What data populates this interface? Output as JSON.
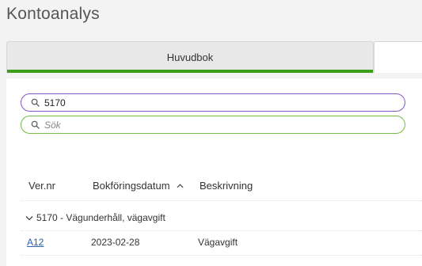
{
  "page": {
    "title": "Kontoanalys"
  },
  "tabs": [
    {
      "label": "Huvudbok",
      "active": true
    },
    {
      "label": "",
      "active": false
    }
  ],
  "search": {
    "filter_value": "5170",
    "placeholder": "Sök"
  },
  "table": {
    "columns": [
      "Ver.nr",
      "Bokföringsdatum",
      "Beskrivning"
    ],
    "sort_column": "Bokföringsdatum",
    "sort_direction": "ascending",
    "groups": [
      {
        "label": "5170 - Vägunderhåll, vägavgift",
        "expanded": true,
        "rows": [
          {
            "vernr": "A12",
            "date": "2023-02-28",
            "description": "Vägavgift"
          }
        ]
      }
    ]
  },
  "colors": {
    "active_tab_accent": "#3f9d1c",
    "filled_search_border": "#8257c9",
    "empty_search_border": "#78b846",
    "link": "#2a62b8"
  },
  "icons": {
    "search": "search-icon",
    "sort": "sort-ascending-icon",
    "expand": "chevron-down-icon"
  }
}
